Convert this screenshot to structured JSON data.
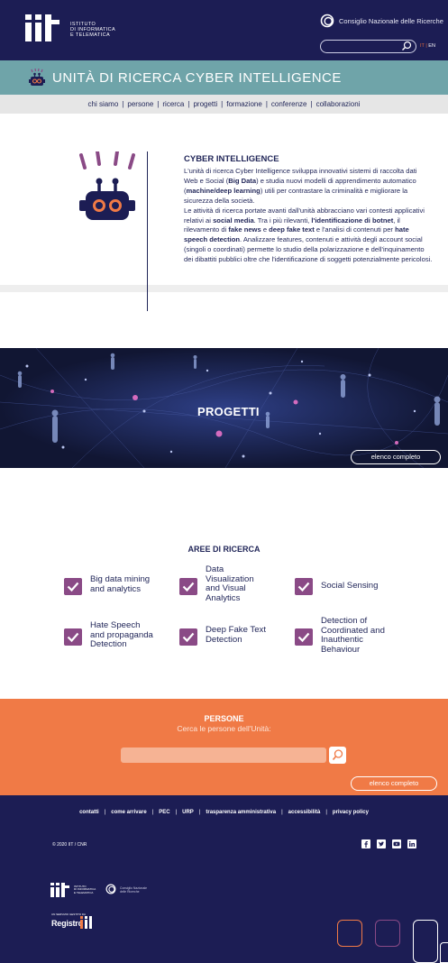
{
  "header": {
    "logo_text_lines": [
      "ISTITUTO",
      "DI INFORMATICA",
      "E TELEMATICA"
    ],
    "cnr_label": "Consiglio Nazionale delle Ricerche",
    "search_placeholder": "",
    "lang_it": "IT",
    "lang_sep": "|",
    "lang_en": "EN"
  },
  "title_bar": {
    "title": "UNITÀ DI RICERCA CYBER INTELLIGENCE"
  },
  "nav": {
    "items": [
      "chi siamo",
      "persone",
      "ricerca",
      "progetti",
      "formazione",
      "conferenze",
      "collaborazioni"
    ],
    "separator": "|"
  },
  "intro": {
    "title": "CYBER INTELLIGENCE",
    "p1_a": "L'unità di ricerca Cyber Intelligence sviluppa innovativi sistemi di raccolta dati Web e Social (",
    "p1_b": "Big Data",
    "p1_c": ") e studia nuovi modelli di apprendimento automatico (",
    "p1_d": "machine/deep learning",
    "p1_e": ") utili per contrastare la criminalità e migliorare la sicurezza della società.",
    "p2_a": "Le attività di ricerca portate avanti dall'unità abbracciano vari contesti applicativi relativi ai ",
    "p2_b": "social media",
    "p2_c": ". Tra i più rilevanti, ",
    "p2_d": "l'identificazione di botnet",
    "p2_e": ", il rilevamento di ",
    "p2_f": "fake news",
    "p2_g": " e ",
    "p2_h": "deep fake text",
    "p2_i": " e l'analisi di contenuti per ",
    "p2_j": "hate speech detection",
    "p2_k": ". Analizzare features, contenuti e attività degli account social (singoli o coordinati) permette lo studio della polarizzazione e dell'inquinamento dei dibattiti pubblici oltre che l'identificazione di soggetti potenzialmente pericolosi."
  },
  "banner": {
    "title": "PROGETTI",
    "button": "elenco completo"
  },
  "aree": {
    "title": "AREE DI RICERCA",
    "items": [
      {
        "lines": [
          "Big data mining",
          "and analytics"
        ]
      },
      {
        "lines": [
          "Data",
          "Visualization",
          "and Visual",
          "Analytics"
        ]
      },
      {
        "lines": [
          "Social Sensing"
        ]
      },
      {
        "lines": [
          "Hate Speech",
          "and propaganda",
          "Detection"
        ]
      },
      {
        "lines": [
          "Deep Fake Text",
          "Detection"
        ]
      },
      {
        "lines": [
          "Detection of",
          "Coordinated and",
          "Inauthentic",
          "Behaviour"
        ]
      }
    ],
    "check_color": "#8a4a86"
  },
  "persone": {
    "title": "PERSONE",
    "subtitle": "Cerca le persone dell'Unità:",
    "search_value": "",
    "button": "elenco completo",
    "bg_color": "#f07a46"
  },
  "footer": {
    "links": [
      "contatti",
      "come arrivare",
      "PEC",
      "URP",
      "trasparenza amministrativa",
      "accessibilità",
      "privacy policy"
    ],
    "separator": "|",
    "copyright": "© 2020 IIT / CNR",
    "social_icons": [
      "facebook-icon",
      "twitter-icon",
      "youtube-icon",
      "linkedin-icon"
    ],
    "logo_lines": [
      "ISTITUTO",
      "DI INFORMATICA",
      "E TELEMATICA"
    ],
    "cnr_lines": [
      "Consiglio Nazionale",
      "delle Ricerche"
    ],
    "registro_small": "UN SERVIZIO GESTITO DA",
    "registro_text": "Registro",
    "bg_color": "#1c1d54"
  },
  "colors": {
    "navy": "#1c1d54",
    "teal": "#6fa4a9",
    "orange": "#f07a46",
    "purple": "#8a4a86"
  }
}
